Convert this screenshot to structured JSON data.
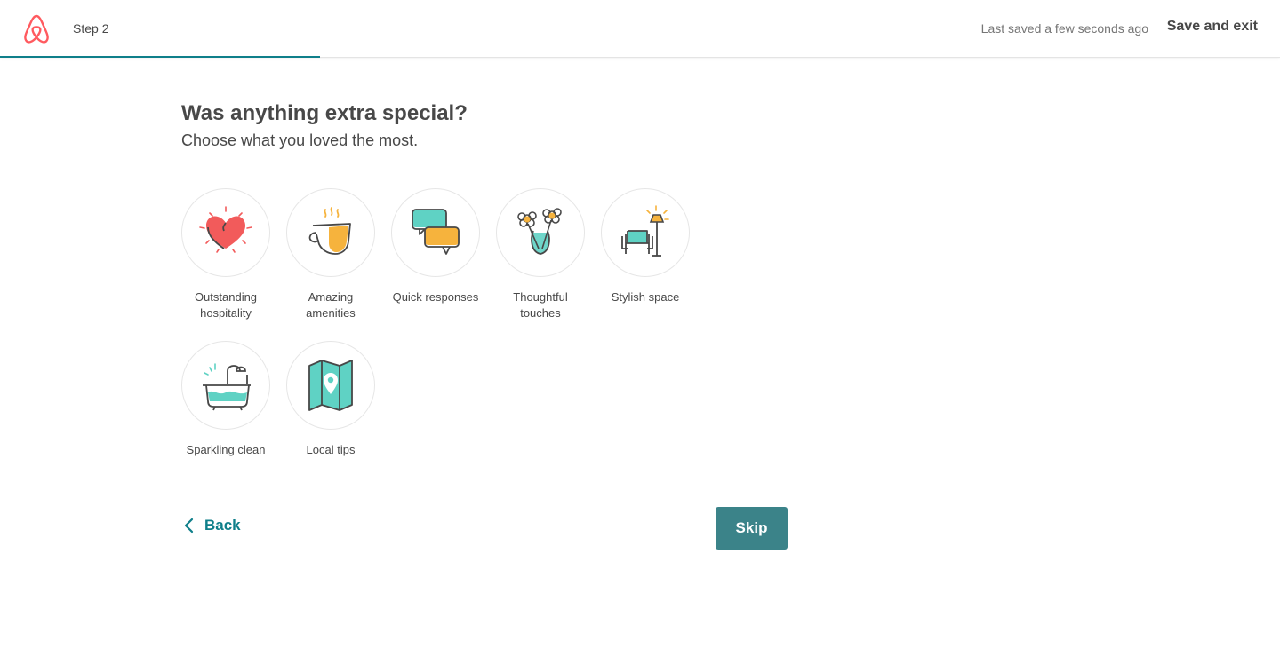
{
  "header": {
    "step_label": "Step 2",
    "saved_status": "Last saved a few seconds ago",
    "save_exit_label": "Save and exit",
    "progress_fraction": 0.25
  },
  "main": {
    "title": "Was anything extra special?",
    "subtitle": "Choose what you loved the most.",
    "options": [
      {
        "label": "Outstanding hospitality",
        "icon": "heart-icon"
      },
      {
        "label": "Amazing amenities",
        "icon": "coffee-cup-icon"
      },
      {
        "label": "Quick responses",
        "icon": "chat-bubbles-icon"
      },
      {
        "label": "Thoughtful touches",
        "icon": "flower-vase-icon"
      },
      {
        "label": "Stylish space",
        "icon": "armchair-lamp-icon"
      },
      {
        "label": "Sparkling clean",
        "icon": "bathtub-icon"
      },
      {
        "label": "Local tips",
        "icon": "map-pin-icon"
      }
    ]
  },
  "footer": {
    "back_label": "Back",
    "skip_label": "Skip"
  },
  "colors": {
    "accent": "#0f7f8a",
    "button": "#3b8389",
    "brand": "#ff5a5f",
    "teal_icon": "#5fd2c4",
    "orange_icon": "#f6b33d",
    "red_icon": "#f25b5b"
  }
}
